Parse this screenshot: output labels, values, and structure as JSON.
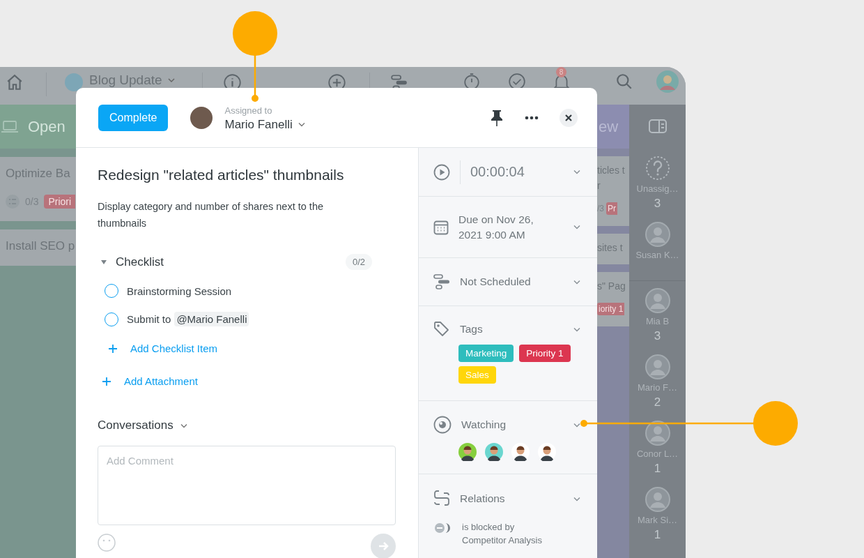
{
  "topbar": {
    "project": "Blog Update",
    "notification_count": "8"
  },
  "board": {
    "open_column": {
      "title": "Open",
      "cards": [
        {
          "title": "Optimize Ba",
          "checklist": "0/3",
          "tag": "Priori"
        },
        {
          "title": "Install SEO p"
        }
      ]
    },
    "review_column": {
      "title": "ew",
      "cards": [
        {
          "lines": [
            "ticles t",
            "r"
          ],
          "checklist": "/3",
          "tag": "Pr"
        },
        {
          "lines": [
            "sites t"
          ]
        },
        {
          "lines": [
            "s\" Pag"
          ],
          "tag": "iority 1"
        }
      ]
    }
  },
  "assignees": [
    {
      "kind": "unassigned",
      "name": "Unassig…",
      "count": "3"
    },
    {
      "kind": "person",
      "name": "Susan K…"
    },
    {
      "kind": "person",
      "name": "Mia B",
      "count": "3"
    },
    {
      "kind": "person",
      "name": "Mario F…",
      "count": "2"
    },
    {
      "kind": "person",
      "name": "Conor L…",
      "count": "1"
    },
    {
      "kind": "person",
      "name": "Mark Si…",
      "count": "1"
    }
  ],
  "task": {
    "complete_button": "Complete",
    "assigned_label": "Assigned to",
    "assignee": "Mario Fanelli",
    "title": "Redesign \"related articles\" thumbnails",
    "description": "Display category and number of shares next to the thumbnails",
    "checklist": {
      "title": "Checklist",
      "expanded": true,
      "progress": "0/2",
      "items": [
        {
          "text": "Brainstorming Session",
          "checked": false
        },
        {
          "text": "Submit to",
          "mention": "@Mario Fanelli",
          "checked": false
        }
      ],
      "add_item": "Add Checklist Item"
    },
    "add_attachment": "Add Attachment",
    "conversations": {
      "title": "Conversations",
      "placeholder": "Add Comment"
    },
    "timer": "00:00:04",
    "due": "Due on Nov 26, 2021 9:00 AM",
    "schedule": "Not Scheduled",
    "tags_title": "Tags",
    "tags": [
      {
        "label": "Marketing",
        "color": "#2ebdbd"
      },
      {
        "label": "Priority 1",
        "color": "#dc3650"
      },
      {
        "label": "Sales",
        "color": "#ffd60a"
      }
    ],
    "watching_title": "Watching",
    "watchers": [
      {
        "color": "#86cf3e"
      },
      {
        "color": "#6ad6cf"
      },
      {
        "color": "#ffffff"
      },
      {
        "color": "#ffffff"
      }
    ],
    "relations_title": "Relations",
    "relation": {
      "type": "is blocked by",
      "task": "Competitor Analysis"
    }
  }
}
